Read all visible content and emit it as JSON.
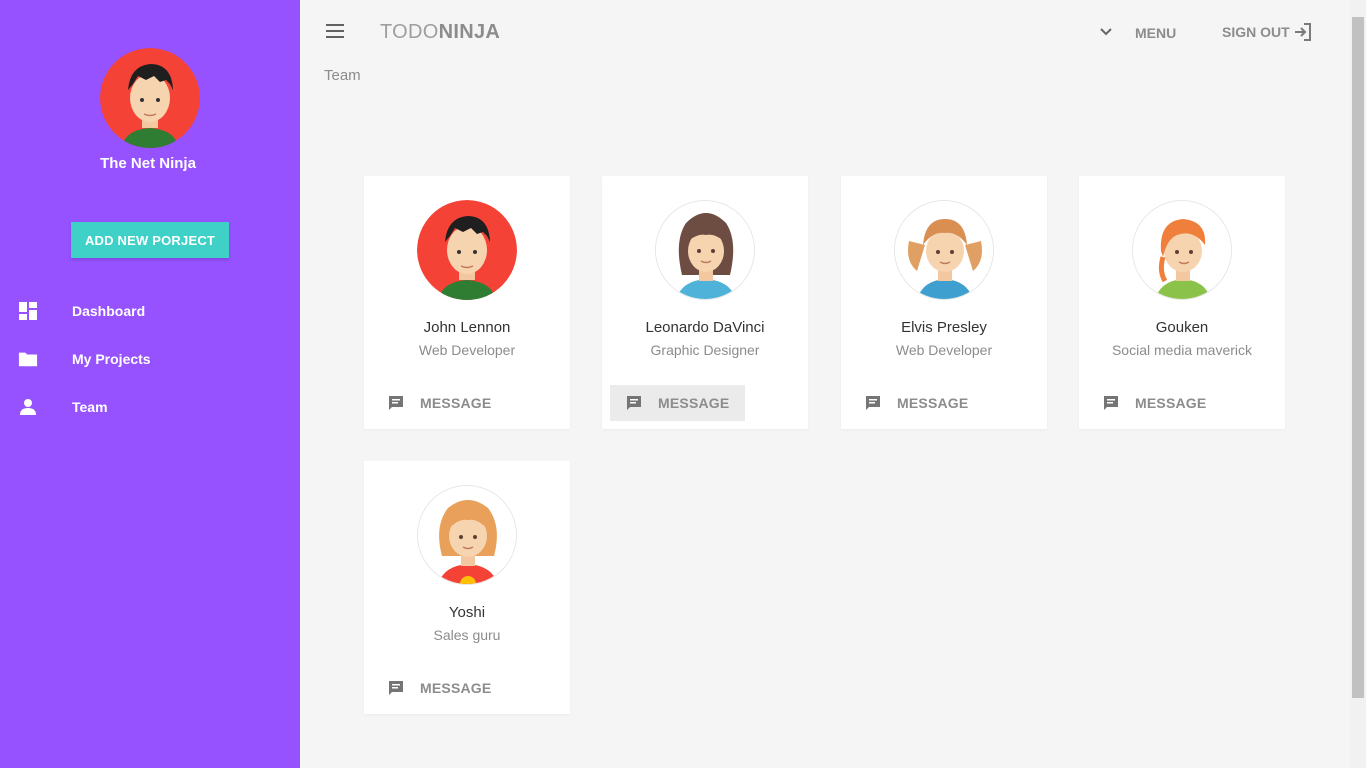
{
  "app": {
    "brand_light": "TODO",
    "brand_bold": "NINJA"
  },
  "toolbar": {
    "menu_label": "MENU",
    "signout_label": "SIGN OUT"
  },
  "sidebar": {
    "user_name": "The Net Ninja",
    "add_button": "ADD NEW PORJECT",
    "items": [
      {
        "label": "Dashboard",
        "icon": "dashboard-icon"
      },
      {
        "label": "My Projects",
        "icon": "folder-icon"
      },
      {
        "label": "Team",
        "icon": "person-icon"
      }
    ]
  },
  "page": {
    "title": "Team"
  },
  "team": [
    {
      "name": "John Lennon",
      "role": "Web Developer",
      "message": "MESSAGE"
    },
    {
      "name": "Leonardo DaVinci",
      "role": "Graphic Designer",
      "message": "MESSAGE"
    },
    {
      "name": "Elvis Presley",
      "role": "Web Developer",
      "message": "MESSAGE"
    },
    {
      "name": "Gouken",
      "role": "Social media maverick",
      "message": "MESSAGE"
    },
    {
      "name": "Yoshi",
      "role": "Sales guru",
      "message": "MESSAGE"
    }
  ],
  "colors": {
    "sidebar": "#9652ff",
    "accent": "#3fd1c8",
    "background": "#f5f5f5"
  }
}
